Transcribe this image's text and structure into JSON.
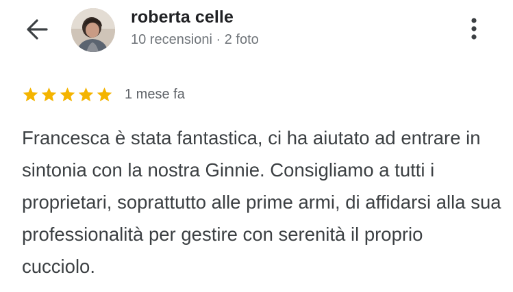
{
  "header": {
    "back_icon": "arrow-back-icon",
    "avatar_icon": "user-avatar",
    "reviewer_name": "roberta celle",
    "reviewer_meta": "10 recensioni · 2 foto",
    "more_icon": "more-vert-icon"
  },
  "review": {
    "rating": 5,
    "rating_max": 5,
    "star_color": "#f4b400",
    "date": "1 mese fa",
    "text": "Francesca è stata fantastica, ci ha aiutato ad entrare in sintonia con la nostra Ginnie. Consigliamo a tutti i proprietari, soprattutto alle prime armi, di affidarsi alla sua professionalità per gestire con serenità il proprio cucciolo."
  }
}
